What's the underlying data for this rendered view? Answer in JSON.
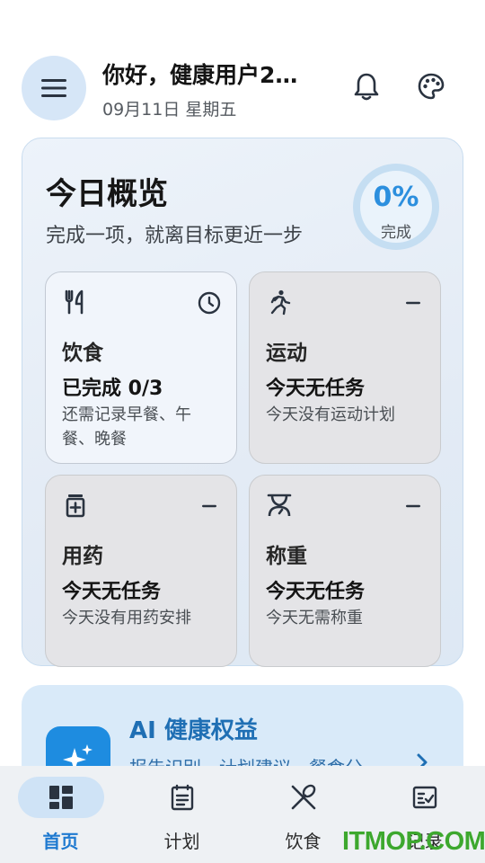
{
  "header": {
    "greeting": "你好，健康用户2…",
    "date": "09月11日 星期五",
    "menu_icon": "menu-icon",
    "bell_icon": "bell-icon",
    "palette_icon": "palette-icon"
  },
  "overview": {
    "title": "今日概览",
    "subtitle": "完成一项，就离目标更近一步",
    "progress_percent": "0%",
    "progress_label": "完成",
    "progress_value": 0
  },
  "tiles": [
    {
      "name": "饮食",
      "state": "已完成 0/3",
      "desc": "还需记录早餐、午餐、晚餐",
      "icon": "utensils-icon",
      "status_icon": "clock-icon",
      "active": true
    },
    {
      "name": "运动",
      "state": "今天无任务",
      "desc": "今天没有运动计划",
      "icon": "running-icon",
      "status_icon": "minus-icon",
      "active": false
    },
    {
      "name": "用药",
      "state": "今天无任务",
      "desc": "今天没有用药安排",
      "icon": "medicine-icon",
      "status_icon": "minus-icon",
      "active": false
    },
    {
      "name": "称重",
      "state": "今天无任务",
      "desc": "今天无需称重",
      "icon": "scale-icon",
      "status_icon": "minus-icon",
      "active": false
    }
  ],
  "ai_card": {
    "title": "AI 健康权益",
    "desc": "报告识别、计划建议、餐食分",
    "icon": "sparkle-icon",
    "arrow_icon": "chevron-right-icon"
  },
  "nav": [
    {
      "label": "首页",
      "icon": "dashboard-icon",
      "active": true
    },
    {
      "label": "计划",
      "icon": "plan-icon",
      "active": false
    },
    {
      "label": "饮食",
      "icon": "food-icon",
      "active": false
    },
    {
      "label": "记录",
      "icon": "record-icon",
      "active": false
    }
  ],
  "watermark": "ITMOP.COM",
  "colors": {
    "accent": "#2c8fde",
    "nav_active": "#1f7ad0",
    "card_bg": "#e6eef7",
    "ai_icon_bg": "#1e8ce0"
  }
}
